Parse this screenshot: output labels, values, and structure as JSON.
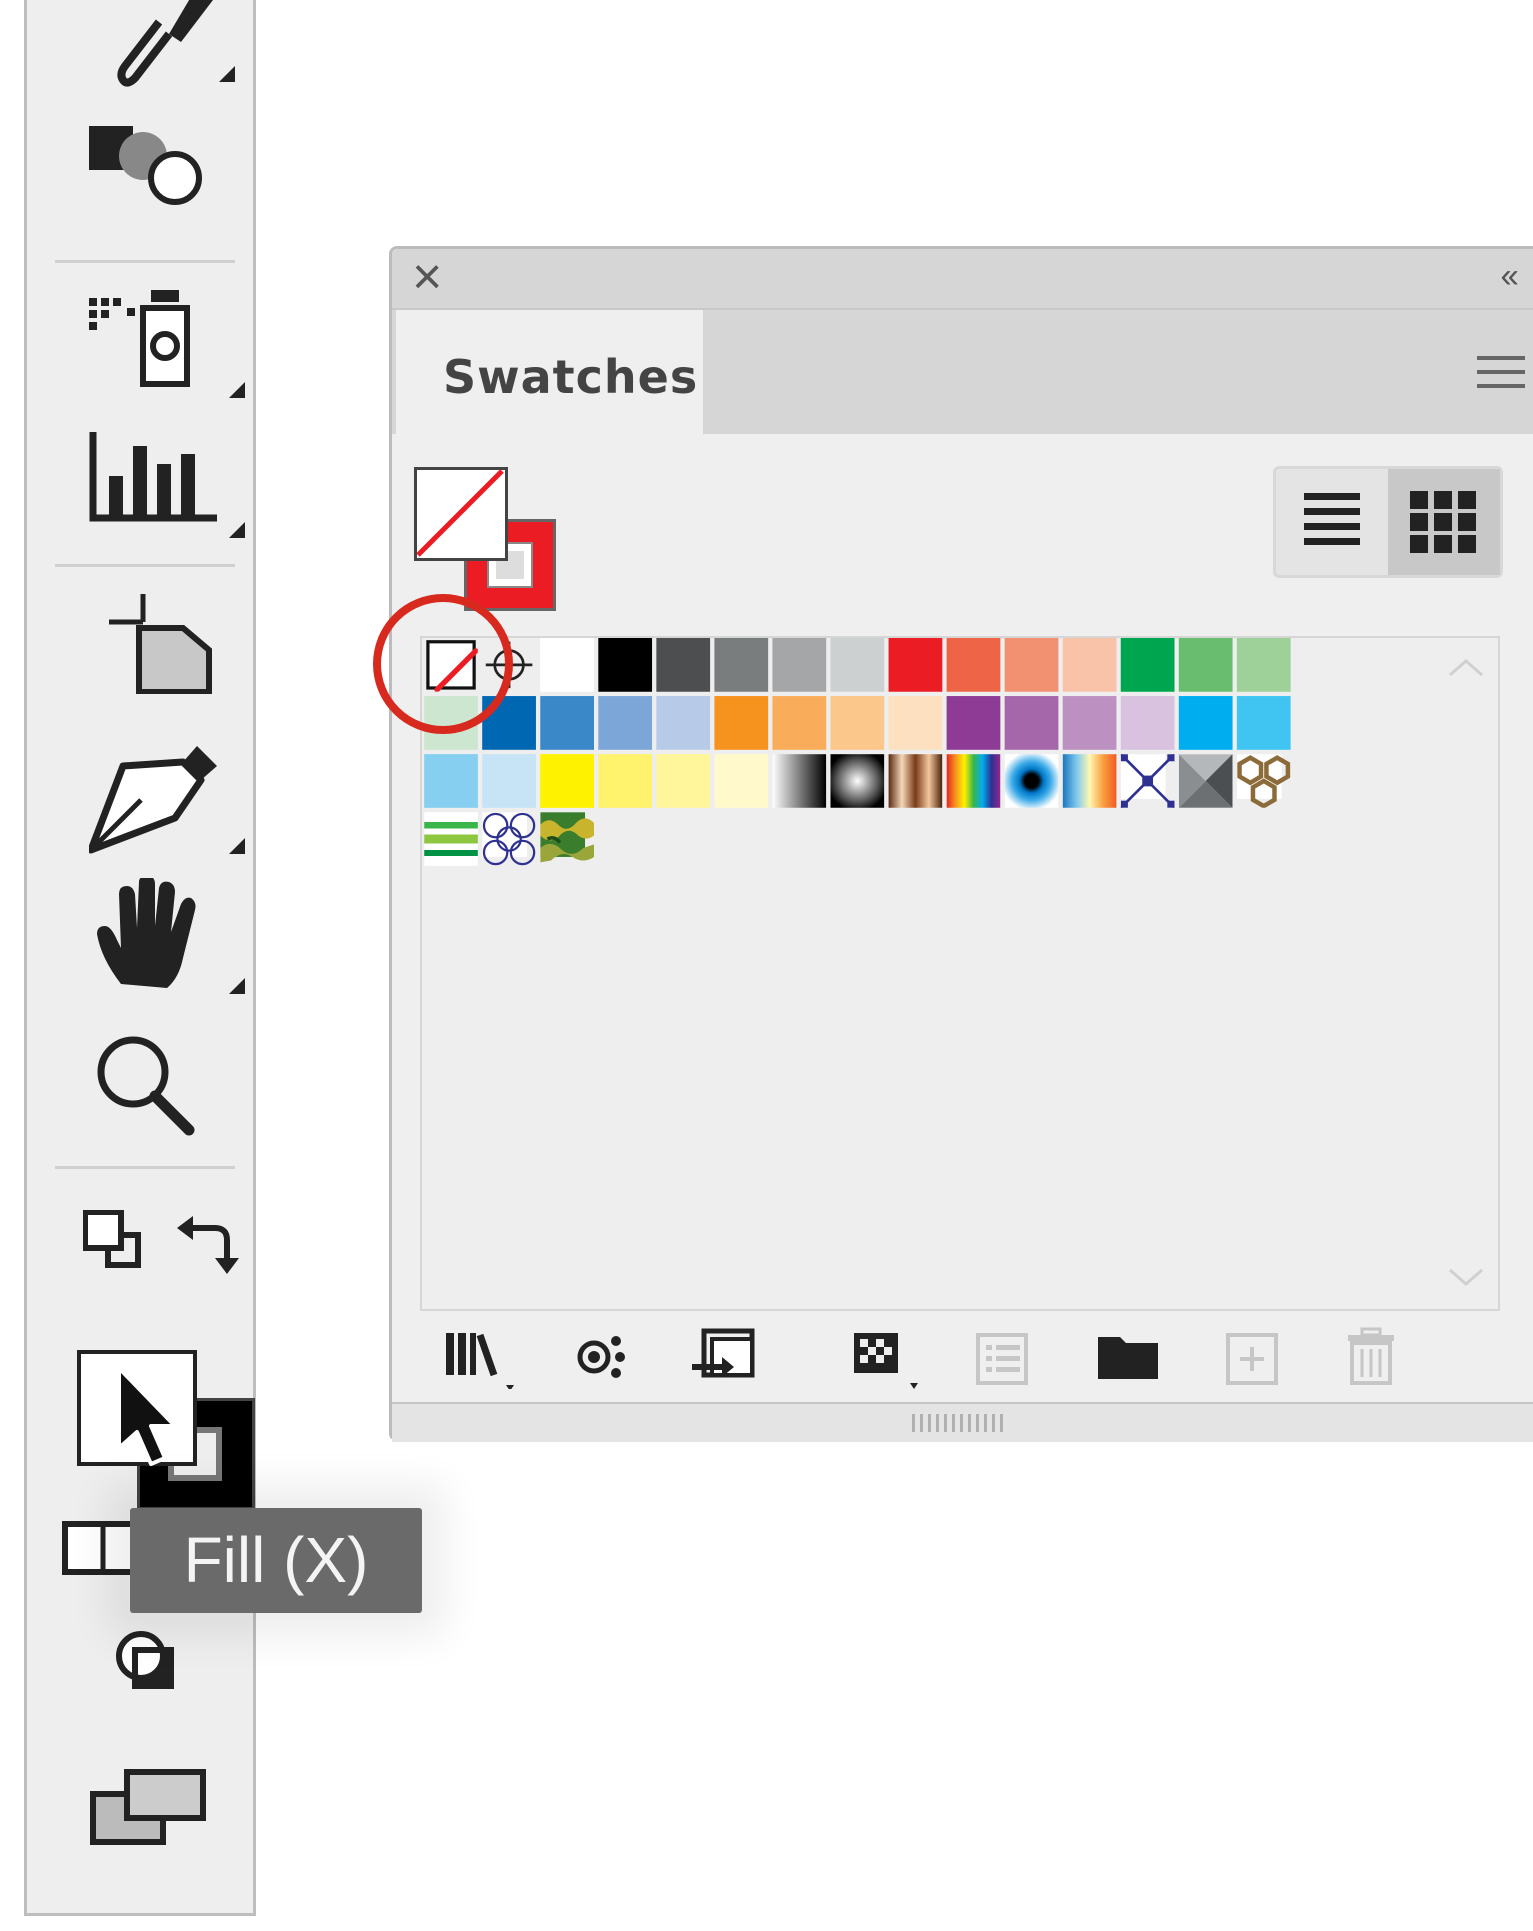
{
  "panel": {
    "tab_label": "Swatches",
    "collapse_glyph": "‹‹",
    "close_glyph": "×"
  },
  "tooltip": {
    "text": "Fill (X)"
  },
  "colors": {
    "highlight_ring": "#d8291f",
    "none_slash": "#ec1c24",
    "stroke_red": "#ec1c24"
  },
  "swatches": {
    "row1": [
      "none",
      "registration",
      "#ffffff",
      "#000000",
      "#4d4e50",
      "#7a7d7e",
      "#a4a6a8",
      "#ccd0d0",
      "#ec1c24",
      "#ee6446",
      "#f19171",
      "#f8c3a8",
      "#00a54f",
      "#68bd6e",
      "#9ed19a"
    ],
    "row2": [
      "#cde6cf",
      "#0067b3",
      "#3a88c8",
      "#7ca6d8",
      "#b7cbe8",
      "#f6921e",
      "#f9ad5a",
      "#fbc78b",
      "#fde0bf",
      "#8e3b96",
      "#a566aa",
      "#bc91c2",
      "#d8c2df",
      "#00aeef",
      "#40c4f2"
    ],
    "row3": [
      "#87cff0",
      "#c6e4f6",
      "#fff200",
      "#fff26c",
      "#fff59b",
      "#fff9cc",
      "gradient-linear-bw",
      "gradient-radial-bw",
      "gradient-copper",
      "gradient-spectrum",
      "gradient-blue-eye",
      "gradient-blue-orange",
      "pattern-diamond",
      "pattern-pyramid",
      "pattern-hex"
    ],
    "row4": [
      "pattern-stripes",
      "pattern-lattice",
      "pattern-camo"
    ]
  }
}
